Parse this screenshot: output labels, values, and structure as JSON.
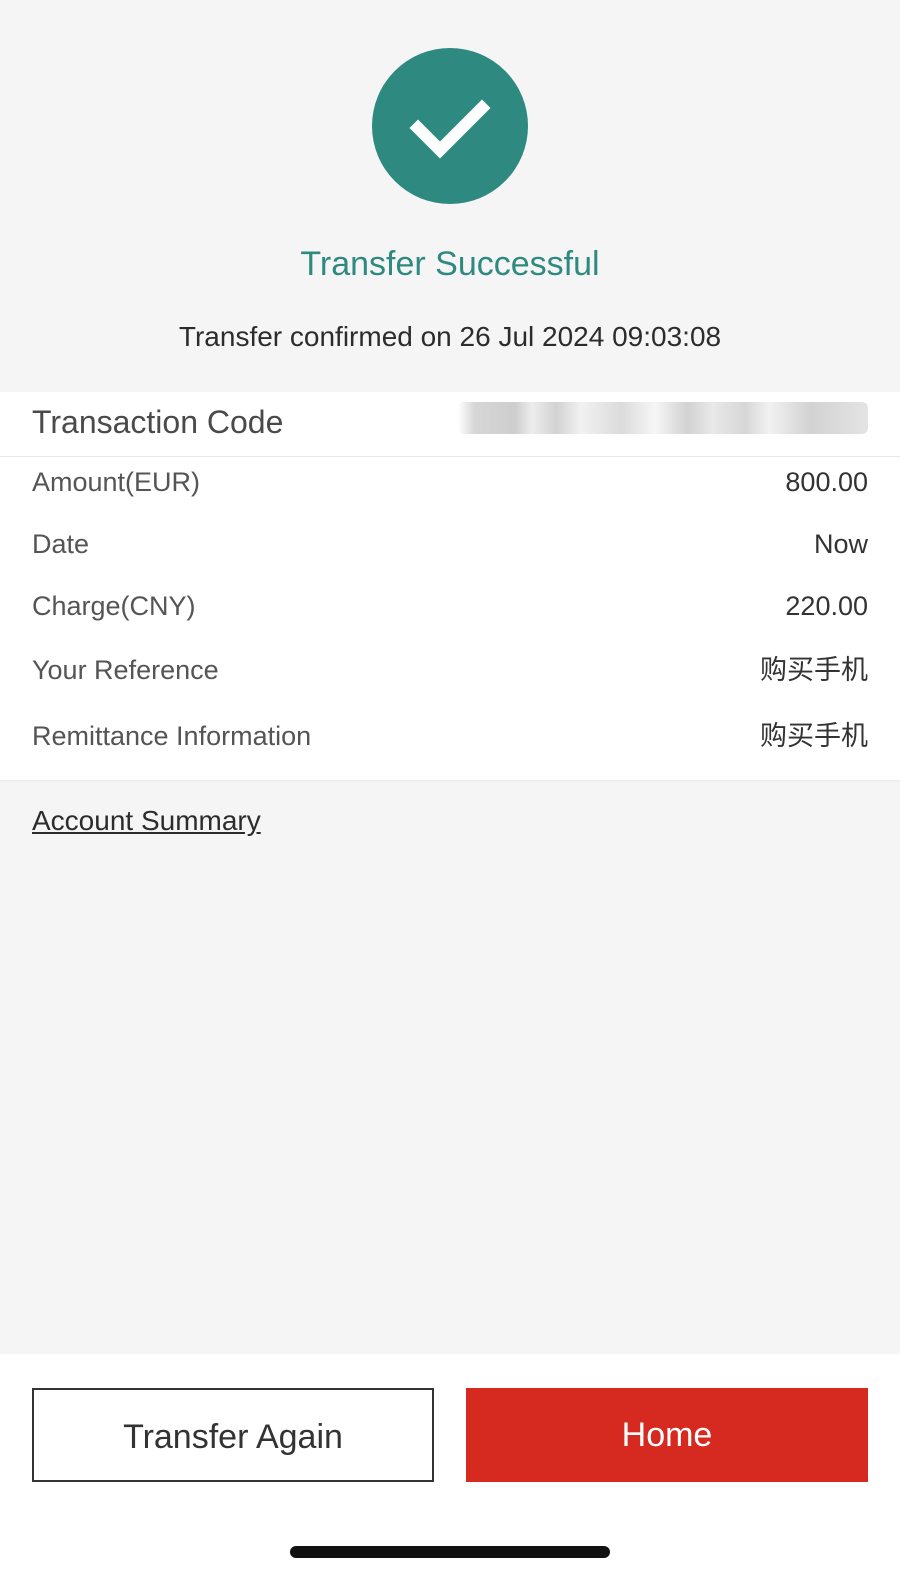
{
  "status": {
    "icon": "checkmark-icon",
    "title": "Transfer Successful",
    "subtitle": "Transfer confirmed on 26 Jul 2024 09:03:08"
  },
  "transaction": {
    "code_label": "Transaction Code",
    "code_value_redacted": true
  },
  "details": [
    {
      "label": "Amount(EUR)",
      "value": "800.00"
    },
    {
      "label": "Date",
      "value": "Now"
    },
    {
      "label": "Charge(CNY)",
      "value": "220.00"
    },
    {
      "label": "Your Reference",
      "value": "购买手机"
    },
    {
      "label": "Remittance Information",
      "value": "购买手机"
    }
  ],
  "links": {
    "account_summary": "Account Summary"
  },
  "buttons": {
    "transfer_again": "Transfer Again",
    "home": "Home"
  },
  "colors": {
    "accent_green": "#2e8a80",
    "primary_red": "#d62a20",
    "background": "#f5f5f5"
  }
}
